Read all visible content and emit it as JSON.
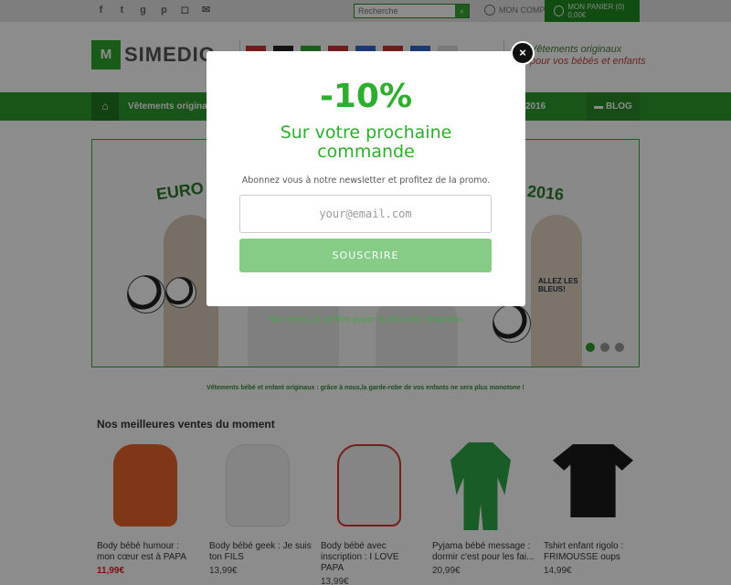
{
  "topbar": {
    "search_placeholder": "Recherche",
    "account_label": "MON COMPTE",
    "cart_label": "MON PANIER (0) 0,00€"
  },
  "header": {
    "logo_text": "SIMEDIO",
    "tagline_1": "Vêtements originaux",
    "tagline_2": "pour vos bébés et enfants"
  },
  "nav": {
    "item_1": "Vêtements originaux",
    "item_2": "2016",
    "blog": "BLOG"
  },
  "hero": {
    "title_left": "EURO",
    "title_right": "2016",
    "shirt_text": "ALLEZ LES BLEUS!"
  },
  "intro_text": "Vêtements bébé et enfant originaux : grâce à nous,la garde-robe de vos enfants ne sera plus monotone !",
  "bestsellers": {
    "title": "Nos meilleures ventes du moment",
    "products": [
      {
        "name": "Body bébé humour : mon cœur est à PAPA",
        "price": "11,99€",
        "color": "#e8652a"
      },
      {
        "name": "Body bébé geek : Je suis ton FILS",
        "price": "13,99€",
        "color": "#f4f4f4"
      },
      {
        "name": "Body bébé avec inscription : I LOVE PAPA",
        "price": "13,99€",
        "color": "#f4f4f4"
      },
      {
        "name": "Pyjama bébé message : dormir c'est pour les fai...",
        "price": "20,99€",
        "color": "#2fa84a"
      },
      {
        "name": "Tshirt enfant rigolo : FRIMOUSSE oups",
        "price": "14,99€",
        "color": "#1a1a1a"
      }
    ]
  },
  "popup": {
    "discount": "-10%",
    "headline_1": "Sur votre prochaine",
    "headline_2": "commande",
    "subtitle": "Abonnez vous à notre newsletter et profitez de la promo.",
    "email_placeholder": "your@email.com",
    "subscribe_label": "SOUSCRIRE",
    "no_thanks": "Non merci, je préfère payer le prix sans réduction.",
    "close_glyph": "×",
    "accent_color": "#2eae2e",
    "button_color": "#86cc86"
  }
}
